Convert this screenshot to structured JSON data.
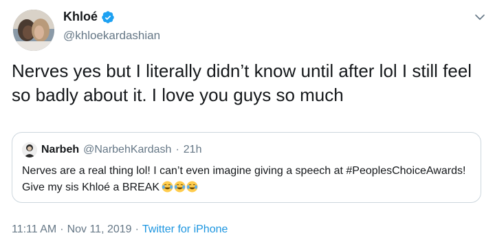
{
  "author": {
    "display_name": "Khloé",
    "handle": "@khloekardashian",
    "verified": true
  },
  "tweet": {
    "text": "Nerves yes but I literally didn’t know until after lol I still feel so badly about it. I love you guys so much"
  },
  "quoted_tweet": {
    "display_name": "Narbeh",
    "handle": "@NarbehKardash",
    "separator": "·",
    "time_ago": "21h",
    "text": "Nerves are a real thing lol! I can’t even imagine giving a speech at #PeoplesChoiceAwards! Give my sis Khloé a BREAK",
    "emoji_icons": [
      "face-with-tears-of-joy-icon",
      "face-with-tears-of-joy-icon",
      "face-with-tears-of-joy-icon"
    ]
  },
  "meta": {
    "time": "11:11 AM",
    "sep1": "·",
    "date": "Nov 11, 2019",
    "sep2": "·",
    "source": "Twitter for iPhone"
  },
  "colors": {
    "verified": "#1da1f2",
    "link": "#1b95e0",
    "secondary_text": "#657786",
    "border": "#ccd6dd"
  }
}
